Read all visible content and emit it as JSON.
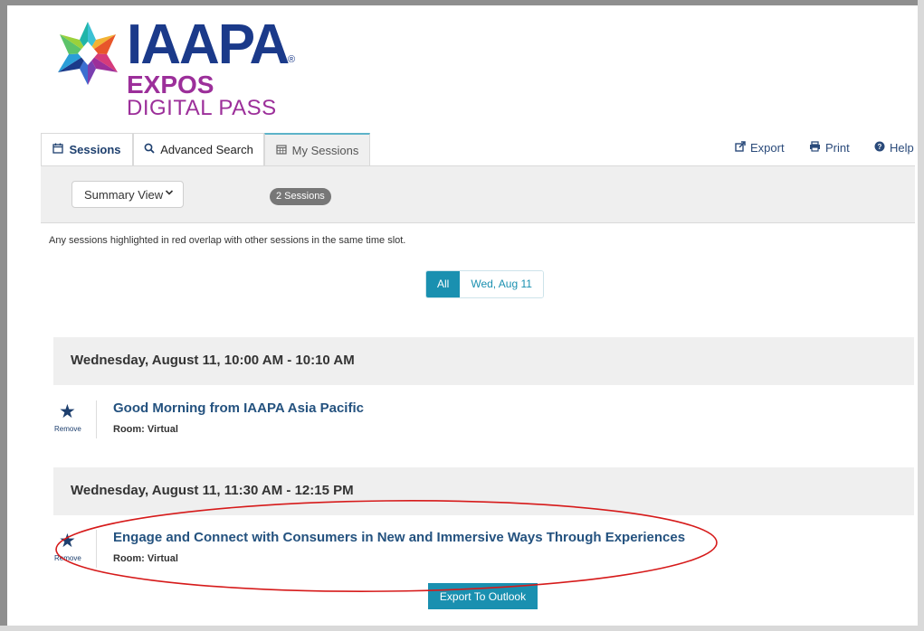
{
  "logo": {
    "word": "IAAPA",
    "registered": "®",
    "line2": "EXPOS",
    "line3": "DIGITAL PASS"
  },
  "tabs": [
    {
      "label": "Sessions",
      "icon": "calendar-outline-icon"
    },
    {
      "label": "Advanced Search",
      "icon": "search-icon"
    },
    {
      "label": "My Sessions",
      "icon": "calendar-grid-icon"
    }
  ],
  "tools": [
    {
      "label": "Export",
      "icon": "share-icon"
    },
    {
      "label": "Print",
      "icon": "print-icon"
    },
    {
      "label": "Help",
      "icon": "question-circle-icon"
    }
  ],
  "toolbar": {
    "view_select": "Summary View",
    "session_count": "2 Sessions"
  },
  "note": "Any sessions highlighted in red overlap with other sessions in the same time slot.",
  "filters": {
    "all": "All",
    "day": "Wed, Aug 11"
  },
  "slots": [
    {
      "title": "Wednesday, August 11, 10:00 AM - 10:10 AM",
      "session": {
        "remove_label": "Remove",
        "title": "Good Morning from IAAPA Asia Pacific",
        "room": "Room: Virtual"
      }
    },
    {
      "title": "Wednesday, August 11, 11:30 AM - 12:15 PM",
      "session": {
        "remove_label": "Remove",
        "title": "Engage and Connect with Consumers in New and Immersive Ways Through Experiences",
        "room": "Room: Virtual"
      }
    }
  ],
  "export_outlook": "Export To Outlook",
  "colors": {
    "brand_navy": "#1b3a8a",
    "brand_purple": "#9c2f9a",
    "accent_teal": "#1a90b0",
    "annotation_red": "#d61a1a"
  }
}
